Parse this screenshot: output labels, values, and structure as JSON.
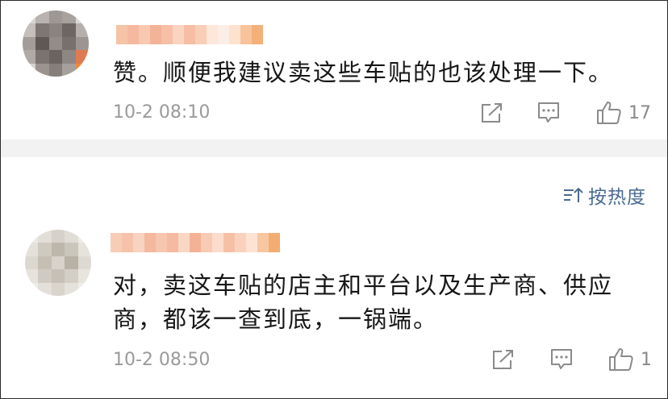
{
  "colors": {
    "link_blue": "#4a6a93",
    "meta_gray": "#9a9a9a",
    "icon_gray": "#8a8a8a",
    "divider": "#f2f2f2"
  },
  "comments": [
    {
      "text": "赞。顺便我建议卖这些车贴的也该处理一下。",
      "time": "10-2 08:10",
      "likes": "17",
      "icons": [
        "share-icon",
        "reply-icon",
        "thumbs-up-icon"
      ]
    },
    {
      "text": "对，卖这车贴的店主和平台以及生产商、供应\n商，都该一查到底，一锅端。",
      "time": "10-2 08:50",
      "likes": "1",
      "icons": [
        "share-icon",
        "reply-icon",
        "thumbs-up-icon"
      ]
    }
  ],
  "sort": {
    "label": "按热度",
    "icon": "sort-icon"
  }
}
